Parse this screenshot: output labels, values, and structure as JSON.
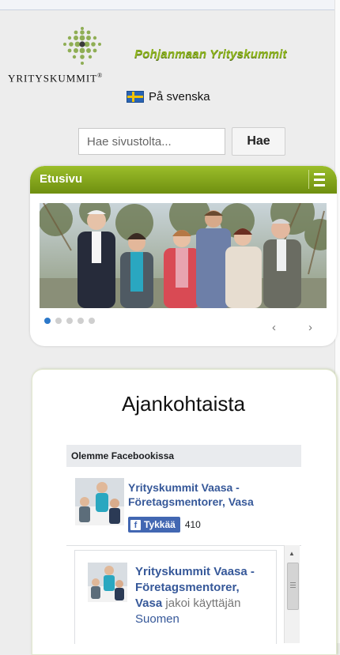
{
  "header": {
    "logo_text": "YRITYSKUMMIT",
    "logo_mark": "®",
    "tagline": "Pohjanmaan Yrityskummit"
  },
  "language": {
    "flag_icon": "sweden-flag-icon",
    "label": "På svenska"
  },
  "search": {
    "placeholder": "Hae sivustolta...",
    "button_label": "Hae"
  },
  "nav": {
    "title": "Etusivu",
    "menu_icon": "hamburger-menu-icon",
    "slider": {
      "slide_count": 5,
      "active_index": 0,
      "prev_label": "‹",
      "next_label": "›"
    }
  },
  "news": {
    "title": "Ajankohtaista",
    "facebook": {
      "header": "Olemme Facebookissa",
      "page_name": "Yrityskummit Vaasa - Företagsmentorer, Vasa",
      "like_label": "Tykkää",
      "like_count": "410",
      "post": {
        "author": "Yrityskummit Vaasa - Företagsmentorer, Vasa",
        "action": "jakoi",
        "continuation_prefix": "käyttäjän",
        "continuation_link": "Suomen"
      }
    }
  },
  "colors": {
    "accent_green": "#8fb51f",
    "nav_green_dark": "#6f8f10",
    "fb_blue": "#4267b2",
    "fb_link": "#365899",
    "slider_active": "#2c78c9"
  }
}
